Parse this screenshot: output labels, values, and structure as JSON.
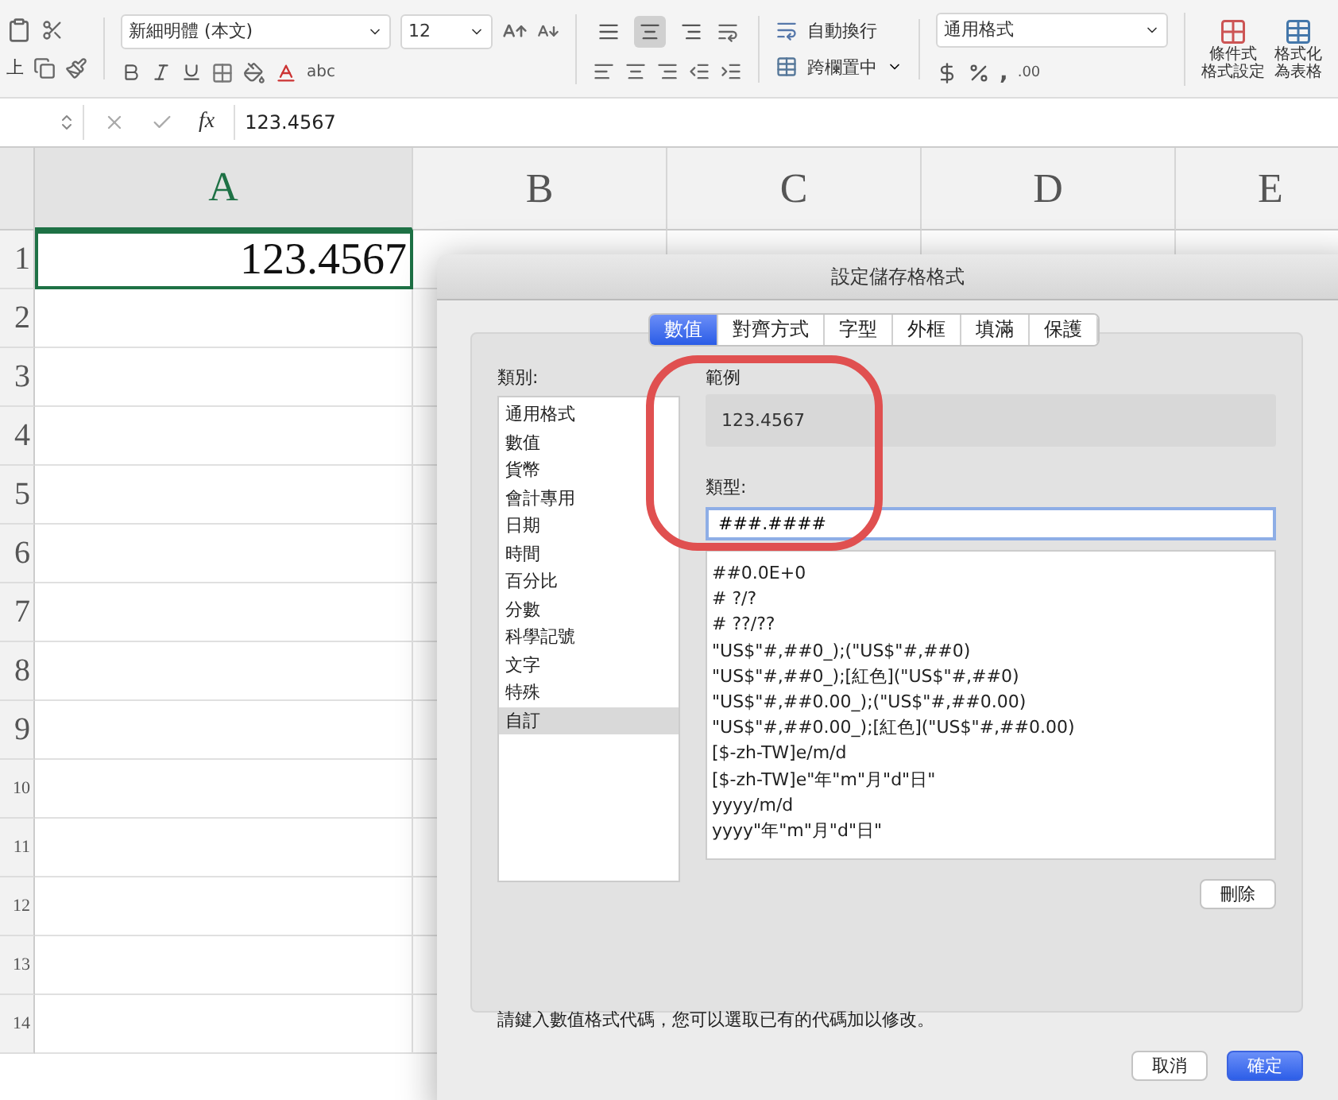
{
  "ribbon": {
    "paste_label": "上",
    "font_name": "新細明體 (本文)",
    "font_size": "12",
    "text_effects": "abc",
    "vertical_align": [
      {
        "selected": false
      },
      {
        "selected": true
      },
      {
        "selected": false
      }
    ],
    "wrap_text": "自動換行",
    "merge_center": "跨欄置中",
    "number_format": "通用格式",
    "comma_style": ",",
    "decimal": ".00",
    "conditional_format": [
      "條件式",
      "格式設定"
    ],
    "format_as_table": [
      "格式化",
      "為表格"
    ]
  },
  "formula_bar": {
    "function_label": "fx",
    "value": "123.4567"
  },
  "sheet": {
    "columns": [
      {
        "label": "A",
        "selected": true
      },
      {
        "label": "B",
        "selected": false
      },
      {
        "label": "C",
        "selected": false
      },
      {
        "label": "D",
        "selected": false
      },
      {
        "label": "E",
        "selected": false
      }
    ],
    "rows": [
      "1",
      "2",
      "3",
      "4",
      "5",
      "6",
      "7",
      "8",
      "9",
      "10",
      "11",
      "12",
      "13",
      "14"
    ],
    "cell_a1": {
      "value": "123.4567",
      "selected": true
    }
  },
  "dialog": {
    "title": "設定儲存格格式",
    "tabs": [
      {
        "label": "數值",
        "selected": true
      },
      {
        "label": "對齊方式",
        "selected": false
      },
      {
        "label": "字型",
        "selected": false
      },
      {
        "label": "外框",
        "selected": false
      },
      {
        "label": "填滿",
        "selected": false
      },
      {
        "label": "保護",
        "selected": false
      }
    ],
    "category_label": "類別:",
    "categories": [
      {
        "label": "通用格式",
        "selected": false
      },
      {
        "label": "數值",
        "selected": false
      },
      {
        "label": "貨幣",
        "selected": false
      },
      {
        "label": "會計專用",
        "selected": false
      },
      {
        "label": "日期",
        "selected": false
      },
      {
        "label": "時間",
        "selected": false
      },
      {
        "label": "百分比",
        "selected": false
      },
      {
        "label": "分數",
        "selected": false
      },
      {
        "label": "科學記號",
        "selected": false
      },
      {
        "label": "文字",
        "selected": false
      },
      {
        "label": "特殊",
        "selected": false
      },
      {
        "label": "自訂",
        "selected": true
      }
    ],
    "sample_label": "範例",
    "sample": "123.4567",
    "type_label": "類型:",
    "type_value": "###.####",
    "formats": [
      "##0.0E+0",
      "# ?/?",
      "# ??/??",
      "\"US$\"#,##0_);(\"US$\"#,##0)",
      "\"US$\"#,##0_);[紅色](\"US$\"#,##0)",
      "\"US$\"#,##0.00_);(\"US$\"#,##0.00)",
      "\"US$\"#,##0.00_);[紅色](\"US$\"#,##0.00)",
      "[$-zh-TW]e/m/d",
      "[$-zh-TW]e\"年\"m\"月\"d\"日\"",
      "yyyy/m/d",
      "yyyy\"年\"m\"月\"d\"日\""
    ],
    "delete_button": "刪除",
    "hint": "請鍵入數值格式代碼，您可以選取已有的代碼加以修改。",
    "cancel_button": "取消",
    "ok_button": "確定",
    "highlight": {
      "kind": "ring"
    }
  }
}
